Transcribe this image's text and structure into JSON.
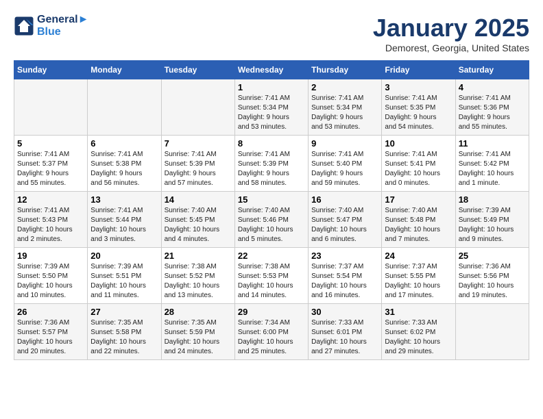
{
  "logo": {
    "line1": "General",
    "line2": "Blue"
  },
  "title": "January 2025",
  "subtitle": "Demorest, Georgia, United States",
  "weekdays": [
    "Sunday",
    "Monday",
    "Tuesday",
    "Wednesday",
    "Thursday",
    "Friday",
    "Saturday"
  ],
  "weeks": [
    [
      {
        "day": "",
        "info": ""
      },
      {
        "day": "",
        "info": ""
      },
      {
        "day": "",
        "info": ""
      },
      {
        "day": "1",
        "info": "Sunrise: 7:41 AM\nSunset: 5:34 PM\nDaylight: 9 hours\nand 53 minutes."
      },
      {
        "day": "2",
        "info": "Sunrise: 7:41 AM\nSunset: 5:34 PM\nDaylight: 9 hours\nand 53 minutes."
      },
      {
        "day": "3",
        "info": "Sunrise: 7:41 AM\nSunset: 5:35 PM\nDaylight: 9 hours\nand 54 minutes."
      },
      {
        "day": "4",
        "info": "Sunrise: 7:41 AM\nSunset: 5:36 PM\nDaylight: 9 hours\nand 55 minutes."
      }
    ],
    [
      {
        "day": "5",
        "info": "Sunrise: 7:41 AM\nSunset: 5:37 PM\nDaylight: 9 hours\nand 55 minutes."
      },
      {
        "day": "6",
        "info": "Sunrise: 7:41 AM\nSunset: 5:38 PM\nDaylight: 9 hours\nand 56 minutes."
      },
      {
        "day": "7",
        "info": "Sunrise: 7:41 AM\nSunset: 5:39 PM\nDaylight: 9 hours\nand 57 minutes."
      },
      {
        "day": "8",
        "info": "Sunrise: 7:41 AM\nSunset: 5:39 PM\nDaylight: 9 hours\nand 58 minutes."
      },
      {
        "day": "9",
        "info": "Sunrise: 7:41 AM\nSunset: 5:40 PM\nDaylight: 9 hours\nand 59 minutes."
      },
      {
        "day": "10",
        "info": "Sunrise: 7:41 AM\nSunset: 5:41 PM\nDaylight: 10 hours\nand 0 minutes."
      },
      {
        "day": "11",
        "info": "Sunrise: 7:41 AM\nSunset: 5:42 PM\nDaylight: 10 hours\nand 1 minute."
      }
    ],
    [
      {
        "day": "12",
        "info": "Sunrise: 7:41 AM\nSunset: 5:43 PM\nDaylight: 10 hours\nand 2 minutes."
      },
      {
        "day": "13",
        "info": "Sunrise: 7:41 AM\nSunset: 5:44 PM\nDaylight: 10 hours\nand 3 minutes."
      },
      {
        "day": "14",
        "info": "Sunrise: 7:40 AM\nSunset: 5:45 PM\nDaylight: 10 hours\nand 4 minutes."
      },
      {
        "day": "15",
        "info": "Sunrise: 7:40 AM\nSunset: 5:46 PM\nDaylight: 10 hours\nand 5 minutes."
      },
      {
        "day": "16",
        "info": "Sunrise: 7:40 AM\nSunset: 5:47 PM\nDaylight: 10 hours\nand 6 minutes."
      },
      {
        "day": "17",
        "info": "Sunrise: 7:40 AM\nSunset: 5:48 PM\nDaylight: 10 hours\nand 7 minutes."
      },
      {
        "day": "18",
        "info": "Sunrise: 7:39 AM\nSunset: 5:49 PM\nDaylight: 10 hours\nand 9 minutes."
      }
    ],
    [
      {
        "day": "19",
        "info": "Sunrise: 7:39 AM\nSunset: 5:50 PM\nDaylight: 10 hours\nand 10 minutes."
      },
      {
        "day": "20",
        "info": "Sunrise: 7:39 AM\nSunset: 5:51 PM\nDaylight: 10 hours\nand 11 minutes."
      },
      {
        "day": "21",
        "info": "Sunrise: 7:38 AM\nSunset: 5:52 PM\nDaylight: 10 hours\nand 13 minutes."
      },
      {
        "day": "22",
        "info": "Sunrise: 7:38 AM\nSunset: 5:53 PM\nDaylight: 10 hours\nand 14 minutes."
      },
      {
        "day": "23",
        "info": "Sunrise: 7:37 AM\nSunset: 5:54 PM\nDaylight: 10 hours\nand 16 minutes."
      },
      {
        "day": "24",
        "info": "Sunrise: 7:37 AM\nSunset: 5:55 PM\nDaylight: 10 hours\nand 17 minutes."
      },
      {
        "day": "25",
        "info": "Sunrise: 7:36 AM\nSunset: 5:56 PM\nDaylight: 10 hours\nand 19 minutes."
      }
    ],
    [
      {
        "day": "26",
        "info": "Sunrise: 7:36 AM\nSunset: 5:57 PM\nDaylight: 10 hours\nand 20 minutes."
      },
      {
        "day": "27",
        "info": "Sunrise: 7:35 AM\nSunset: 5:58 PM\nDaylight: 10 hours\nand 22 minutes."
      },
      {
        "day": "28",
        "info": "Sunrise: 7:35 AM\nSunset: 5:59 PM\nDaylight: 10 hours\nand 24 minutes."
      },
      {
        "day": "29",
        "info": "Sunrise: 7:34 AM\nSunset: 6:00 PM\nDaylight: 10 hours\nand 25 minutes."
      },
      {
        "day": "30",
        "info": "Sunrise: 7:33 AM\nSunset: 6:01 PM\nDaylight: 10 hours\nand 27 minutes."
      },
      {
        "day": "31",
        "info": "Sunrise: 7:33 AM\nSunset: 6:02 PM\nDaylight: 10 hours\nand 29 minutes."
      },
      {
        "day": "",
        "info": ""
      }
    ]
  ]
}
